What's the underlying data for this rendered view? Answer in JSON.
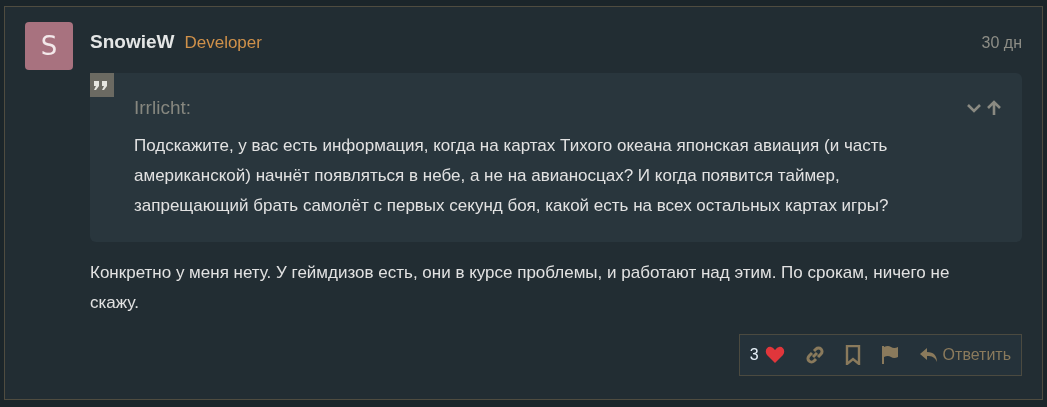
{
  "post": {
    "avatar_letter": "S",
    "author": "SnowieW",
    "role": "Developer",
    "time": "30 дн",
    "quote": {
      "author": "Irrlicht:",
      "text": "Подскажите, у вас есть информация, когда на картах Тихого океана японская авиация (и часть американской) начнёт появляться в небе, а не на авианосцах? И когда появится таймер, запрещающий брать самолёт с первых секунд боя, какой есть на всех остальных картах игры?"
    },
    "body": "Конкретно у меня нету. У геймдизов есть, они в курсе проблемы, и работают над этим. По срокам, ничего не скажу.",
    "actions": {
      "likes": "3",
      "liked": true,
      "reply": "Ответить"
    }
  }
}
